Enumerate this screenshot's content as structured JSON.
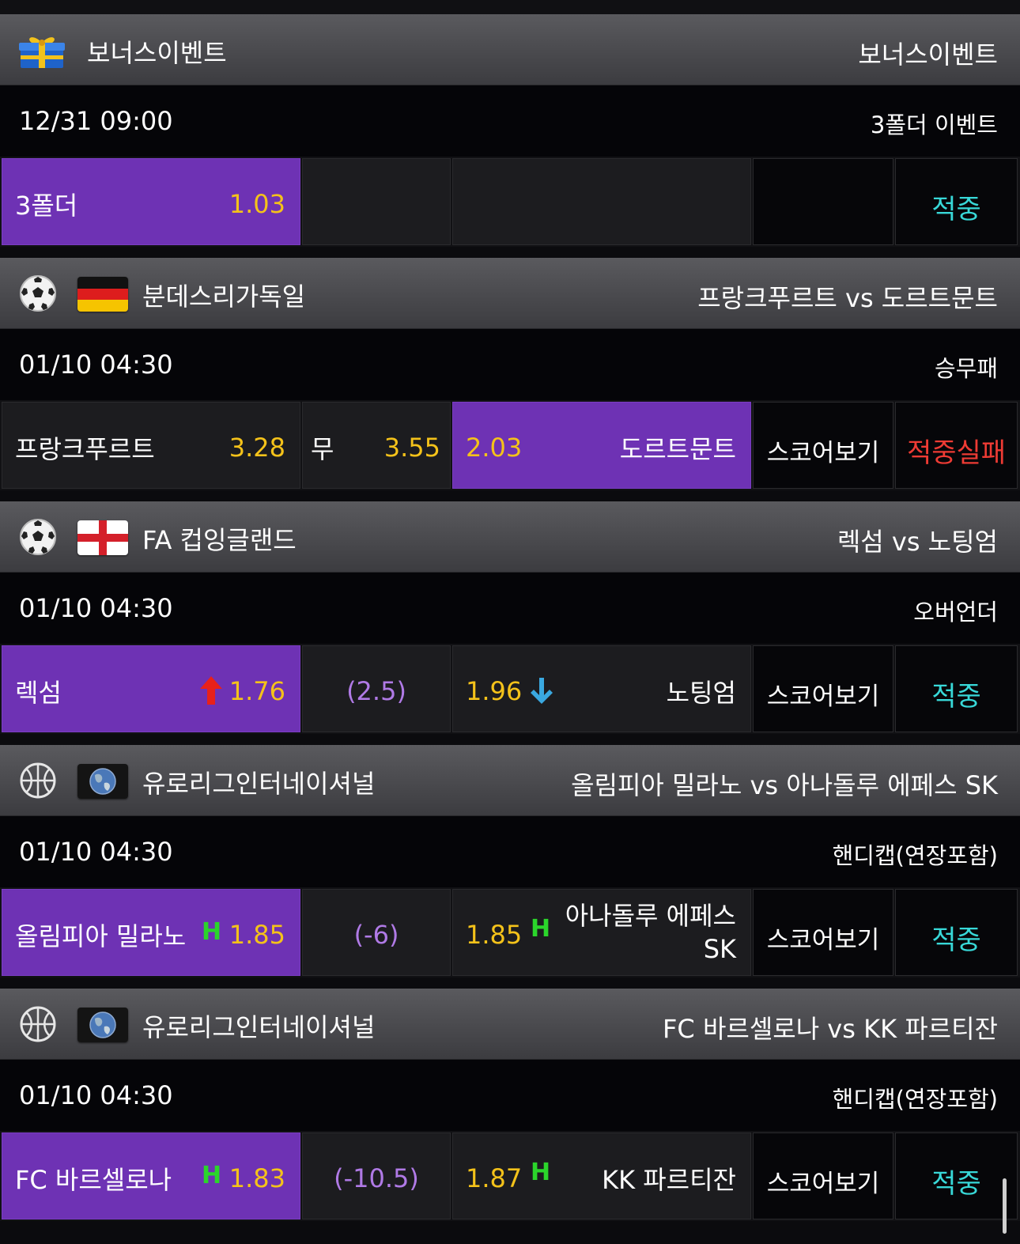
{
  "sections": [
    {
      "league": "보너스이벤트",
      "match": "보너스이벤트",
      "time": "12/31 09:00",
      "market": "3폴더  이벤트",
      "home": {
        "name": "3폴더",
        "odd": "1.03"
      },
      "result": "적중"
    },
    {
      "league": "분데스리가독일",
      "match": "프랑크푸르트 vs 도르트문트",
      "time": "01/10 04:30",
      "market": "승무패",
      "home": {
        "name": "프랑크푸르트",
        "odd": "3.28"
      },
      "draw": {
        "name": "무",
        "odd": "3.55"
      },
      "away": {
        "name": "도르트문트",
        "odd": "2.03"
      },
      "score_label": "스코어보기",
      "result": "적중실패"
    },
    {
      "league": "FA 컵잉글랜드",
      "match": "렉섬 vs 노팅엄",
      "time": "01/10 04:30",
      "market": "오버언더",
      "home": {
        "name": "렉섬",
        "odd": "1.76"
      },
      "line": "(2.5)",
      "away": {
        "name": "노팅엄",
        "odd": "1.96"
      },
      "score_label": "스코어보기",
      "result": "적중"
    },
    {
      "league": "유로리그인터네이셔널",
      "match": "올림피아 밀라노 vs 아나돌루 에페스 SK",
      "time": "01/10 04:30",
      "market": "핸디캡(연장포함)",
      "home": {
        "name": "올림피아 밀라노",
        "odd": "1.85",
        "mark": "H"
      },
      "line": "(-6)",
      "away": {
        "name_line1": "아나돌루 에페스",
        "name_line2": "SK",
        "odd": "1.85",
        "mark": "H"
      },
      "score_label": "스코어보기",
      "result": "적중"
    },
    {
      "league": "유로리그인터네이셔널",
      "match": "FC 바르셀로나 vs KK 파르티잔",
      "time": "01/10 04:30",
      "market": "핸디캡(연장포함)",
      "home": {
        "name": "FC 바르셀로나",
        "odd": "1.83",
        "mark": "H"
      },
      "line": "(-10.5)",
      "away": {
        "name": "KK 파르티잔",
        "odd": "1.87",
        "mark": "H"
      },
      "score_label": "스코어보기",
      "result": "적중"
    }
  ],
  "icons": {
    "s0": "gift-icon",
    "s1": [
      "soccer-ball-icon",
      "germany-flag-icon"
    ],
    "s2": [
      "soccer-ball-icon",
      "england-flag-icon"
    ],
    "s3": [
      "basketball-icon",
      "globe-icon"
    ],
    "s4": [
      "basketball-icon",
      "globe-icon"
    ]
  },
  "colors": {
    "selected": "#6e32b4",
    "odd": "#f4c21a",
    "handicap": "#b07ae6",
    "win": "#38d8d8",
    "lose": "#ee3b34",
    "h_mark": "#2bd52b",
    "up_arrow": "#e8211a",
    "down_arrow": "#3aa8e0"
  }
}
